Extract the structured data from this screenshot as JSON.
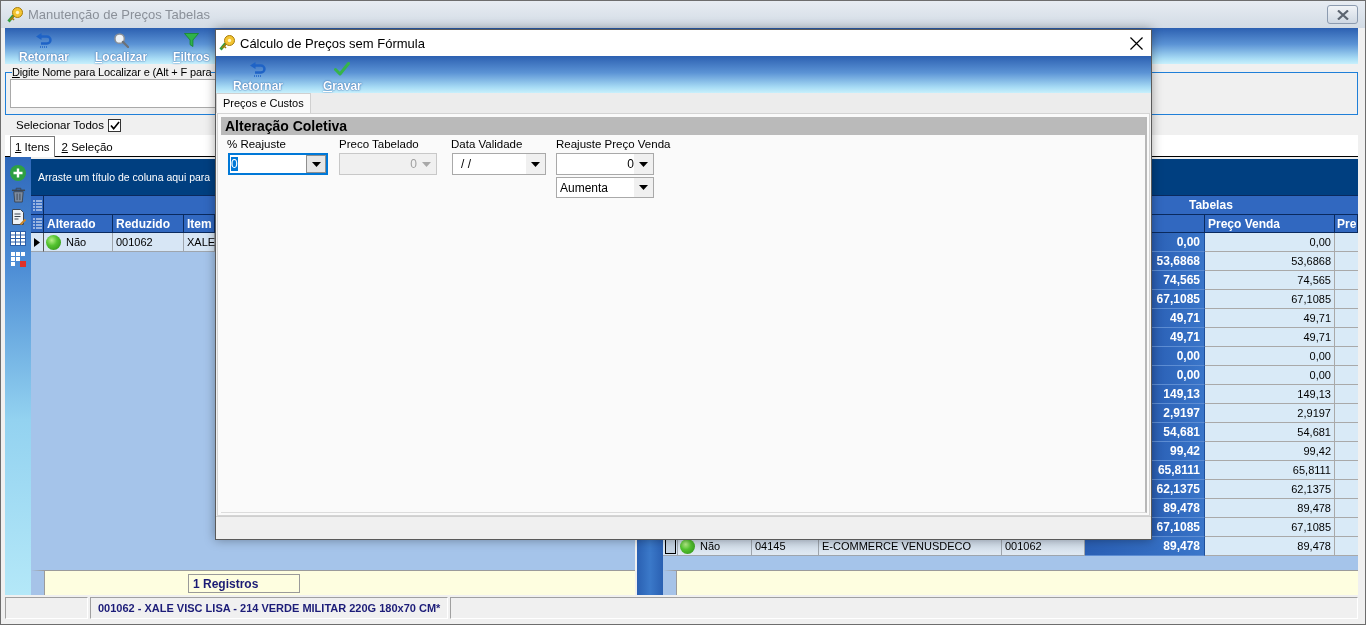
{
  "main_window": {
    "title": "Manutenção de Preços Tabelas",
    "toolbar": [
      {
        "label": "Retornar",
        "kind": "return",
        "access_key": false
      },
      {
        "label": "Localizar",
        "kind": "search",
        "access_key": true
      },
      {
        "label": "Filtros",
        "kind": "filter",
        "access_key": true
      }
    ],
    "search": {
      "legend": "Digite Nome para Localizar e (Alt + F para",
      "access_key": true
    },
    "select_all": {
      "label": "Selecionar Todos",
      "checked": true
    },
    "tabs": [
      {
        "label": "1 Itens",
        "selected": true,
        "access_key": true
      },
      {
        "label": "2 Seleção",
        "selected": false,
        "access_key": true
      }
    ],
    "items_grid": {
      "focused": true,
      "group_panel": "Arraste um título de coluna aqui para",
      "columns": [
        "Alterado",
        "Reduzido",
        "Item"
      ],
      "rows": [
        {
          "current": true,
          "altered": "Não",
          "reduced": "001062",
          "item": "XALE"
        }
      ],
      "footer": "1 Registros"
    },
    "tables_grid": {
      "focused": false,
      "band": "Tabelas",
      "columns": [
        "Preço Venda",
        "Pre"
      ],
      "rows": [
        {
          "column_5": "0,00",
          "preco_venda": "0,00"
        },
        {
          "column_5": "53,6868",
          "preco_venda": "53,6868"
        },
        {
          "column_5": "74,565",
          "preco_venda": "74,565"
        },
        {
          "column_5": "67,1085",
          "preco_venda": "67,1085"
        },
        {
          "column_5": "49,71",
          "preco_venda": "49,71"
        },
        {
          "column_5": "49,71",
          "preco_venda": "49,71"
        },
        {
          "column_5": "0,00",
          "preco_venda": "0,00"
        },
        {
          "column_5": "0,00",
          "preco_venda": "0,00"
        },
        {
          "column_5": "149,13",
          "preco_venda": "149,13"
        },
        {
          "column_5": "2,9197",
          "preco_venda": "2,9197"
        },
        {
          "column_5": "54,681",
          "preco_venda": "54,681"
        },
        {
          "column_5": "99,42",
          "preco_venda": "99,42"
        },
        {
          "column_5": "65,8111",
          "preco_venda": "65,8111"
        },
        {
          "column_5": "62,1375",
          "preco_venda": "62,1375"
        },
        {
          "column_5": "89,478",
          "preco_venda": "89,478"
        },
        {
          "column_5": "67,1085",
          "preco_venda": "67,1085"
        },
        {
          "current": true,
          "column_1": "Não",
          "column_2": "04145",
          "column_3": "E-COMMERCE VENUSDECO",
          "column_4": "001062",
          "column_5": "89,478",
          "preco_venda": "89,478"
        }
      ]
    },
    "status_bar": {
      "text": "001062 - XALE VISC LISA - 214 VERDE MILITAR 220G 180x70 CM*"
    }
  },
  "dialog": {
    "title": "Cálculo de Preços sem Fórmula",
    "toolbar": [
      {
        "label": "Retornar",
        "kind": "return",
        "access_key": false
      },
      {
        "label": "Gravar",
        "kind": "save",
        "access_key": true
      }
    ],
    "tabs": [
      {
        "label": "Preços e Custos",
        "selected": true
      }
    ],
    "section": {
      "title": "Alteração Coletiva",
      "fields": [
        {
          "label": "% Reajuste",
          "inputs": [
            {
              "kind": "number",
              "value": "0",
              "focused": true,
              "disabled": false
            }
          ]
        },
        {
          "label": "Preco Tabelado",
          "inputs": [
            {
              "kind": "number",
              "value": "0",
              "focused": false,
              "disabled": true
            }
          ]
        },
        {
          "label": "Data Validade",
          "inputs": [
            {
              "kind": "date",
              "value": "/ /",
              "focused": false,
              "disabled": false
            }
          ]
        },
        {
          "label": "Reajuste Preço Venda",
          "inputs": [
            {
              "kind": "number",
              "value": "0",
              "focused": false,
              "disabled": false
            },
            {
              "kind": "select",
              "value": "Aumenta",
              "focused": false,
              "disabled": false
            }
          ]
        }
      ]
    }
  }
}
